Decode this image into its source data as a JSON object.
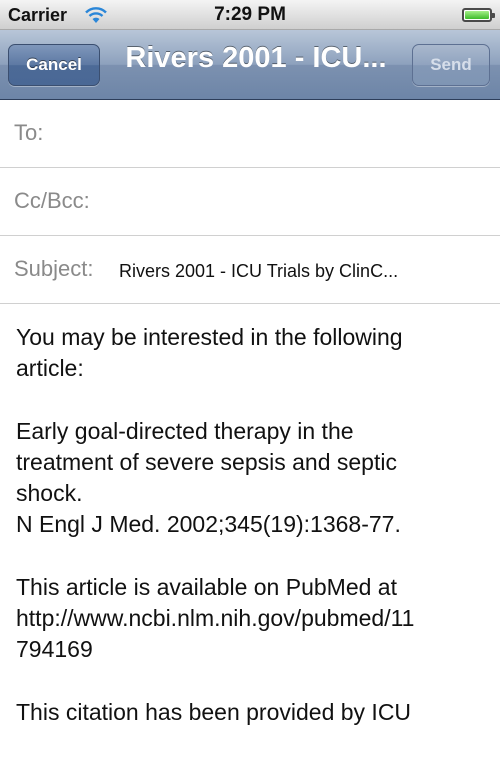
{
  "status_bar": {
    "carrier": "Carrier",
    "time": "7:29 PM",
    "battery_level": 1.0,
    "battery_color": "#3dbb2a"
  },
  "nav_bar": {
    "cancel_label": "Cancel",
    "title": "Rivers 2001 - ICU...",
    "send_label": "Send"
  },
  "fields": {
    "to_label": "To:",
    "cc_label": "Cc/Bcc:",
    "subject_label": "Subject:",
    "subject_value": "Rivers 2001 - ICU Trials by ClinC..."
  },
  "body": {
    "intro_lines": [
      "You may be interested in the following",
      "article:"
    ],
    "citation_lines": [
      "Early goal-directed therapy in the",
      "treatment of severe sepsis and septic",
      "shock.",
      "N Engl J Med. 2002;345(19):1368-77."
    ],
    "pubmed_lines": [
      "This article is available on PubMed at",
      "http://www.ncbi.nlm.nih.gov/pubmed/11",
      "794169"
    ],
    "provided_lines": [
      "This citation has been provided by ICU"
    ]
  },
  "colors": {
    "nav_bar": "#7c91b0",
    "label_gray": "#8a8a8a"
  }
}
